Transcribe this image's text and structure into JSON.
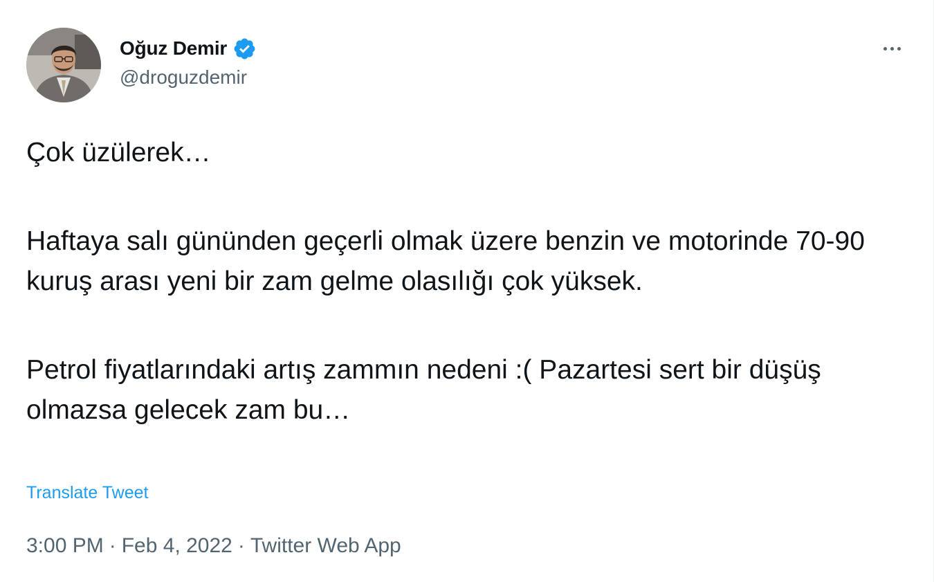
{
  "author": {
    "display_name": "Oğuz Demir",
    "handle": "@droguzdemir",
    "verified": true,
    "verified_icon": "verified-badge-icon",
    "avatar": "avatar-photo"
  },
  "menu": {
    "more_icon": "more-options-icon"
  },
  "tweet": {
    "paragraphs": [
      "Çok üzülerek…",
      "Haftaya salı gününden geçerli olmak üzere benzin ve motorinde 70-90 kuruş arası yeni bir zam gelme olasılığı çok yüksek.",
      "Petrol fiyatlarındaki artış zammın nedeni :( Pazartesi sert bir düşüş olmazsa gelecek zam bu…"
    ],
    "translate_label": "Translate Tweet"
  },
  "meta": {
    "time": "3:00 PM",
    "date": "Feb 4, 2022",
    "source": "Twitter Web App",
    "separator": "·"
  },
  "colors": {
    "text_primary": "#0f1419",
    "text_secondary": "#536471",
    "accent": "#1d9bf0"
  }
}
